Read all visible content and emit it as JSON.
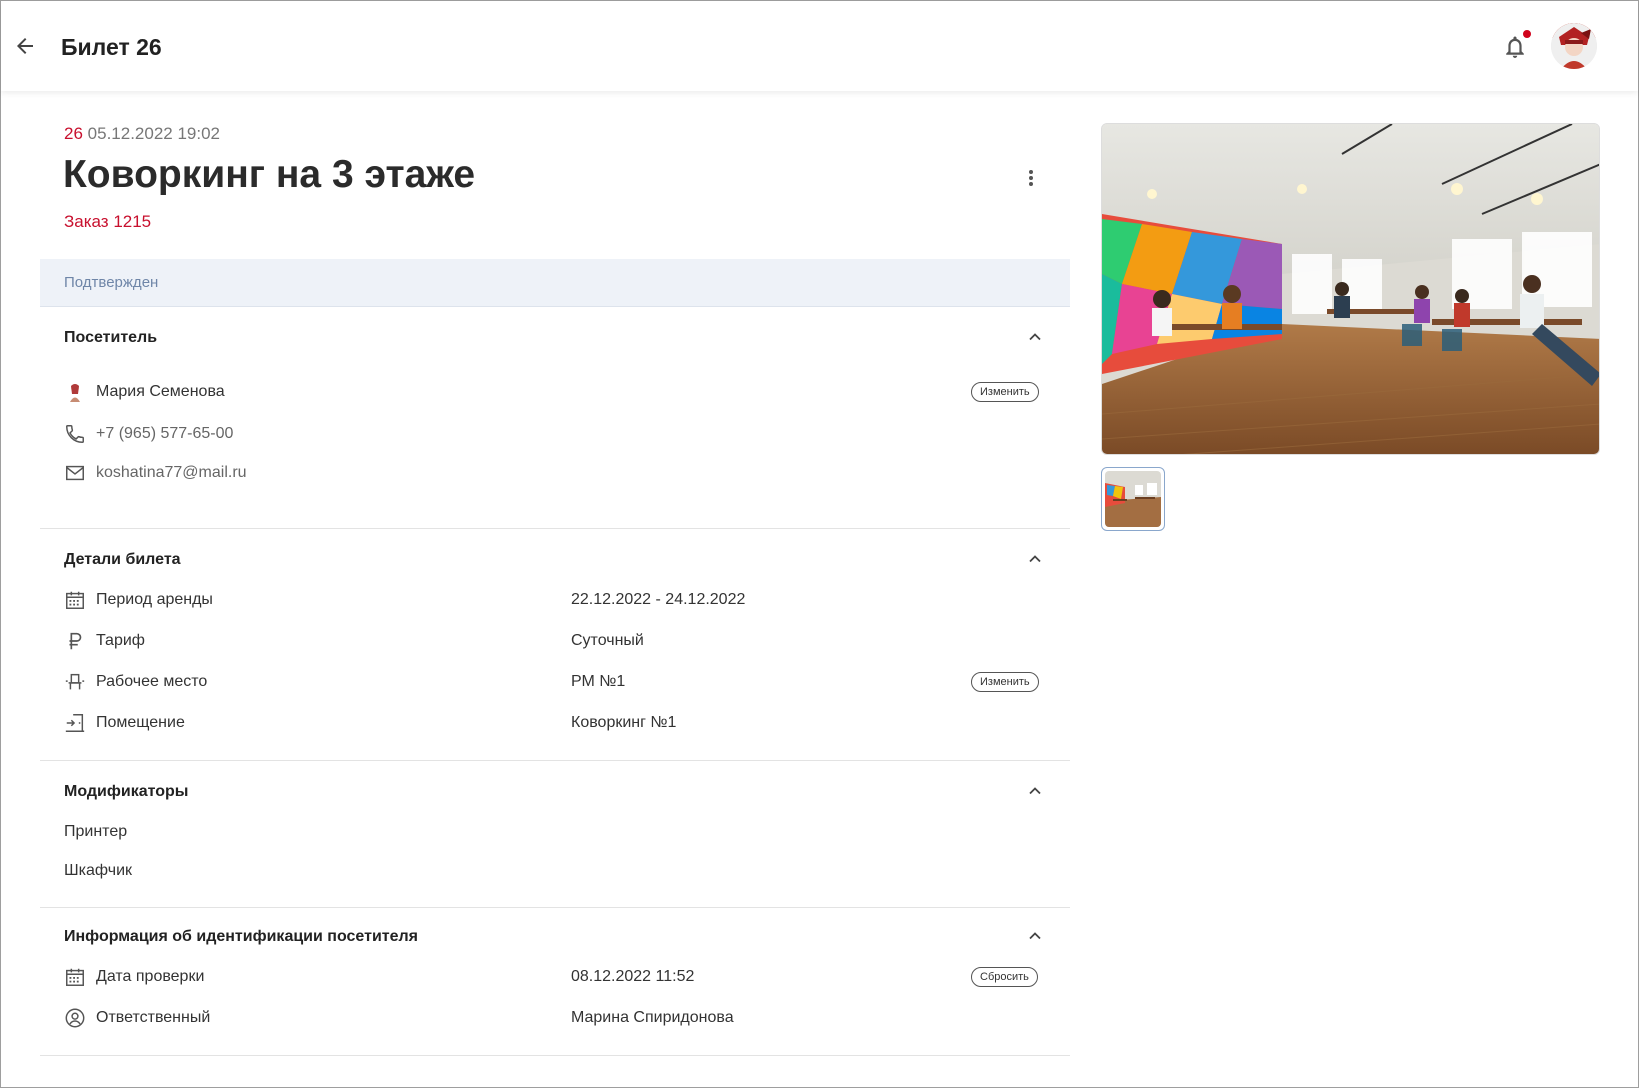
{
  "header": {
    "title": "Билет 26",
    "icons": {
      "back": "arrow-left-icon",
      "notifications": "bell-icon",
      "avatar": "user-avatar"
    },
    "has_unread": true
  },
  "ticket": {
    "number": "26",
    "datetime": "05.12.2022 19:02",
    "title": "Коворкинг на 3 этаже",
    "order_link": "Заказ 1215",
    "status": "Подтвержден"
  },
  "visitor": {
    "title": "Посетитель",
    "name": "Мария Семенова",
    "phone": "+7 (965) 577-65-00",
    "email": "koshatina77@mail.ru",
    "change_label": "Изменить"
  },
  "details": {
    "title": "Детали билета",
    "rows": [
      {
        "label": "Период аренды",
        "value": "22.12.2022 - 24.12.2022",
        "icon": "calendar-icon"
      },
      {
        "label": "Тариф",
        "value": "Суточный",
        "icon": "ruble-icon"
      },
      {
        "label": "Рабочее место",
        "value": "РМ №1",
        "icon": "workplace-icon"
      },
      {
        "label": "Помещение",
        "value": "Коворкинг №1",
        "icon": "door-enter-icon"
      }
    ],
    "change_label": "Изменить"
  },
  "modifiers": {
    "title": "Модификаторы",
    "items": [
      "Принтер",
      "Шкафчик"
    ]
  },
  "identification": {
    "title": "Информация об идентификации посетителя",
    "rows": [
      {
        "label": "Дата проверки",
        "value": "08.12.2022 11:52",
        "icon": "calendar-icon"
      },
      {
        "label": "Ответственный",
        "value": "Марина Спиридонова",
        "icon": "account-circle-icon"
      }
    ],
    "reset_label": "Сбросить"
  },
  "colors": {
    "accent": "#c8102e",
    "status_bg": "#eef2f8",
    "status_text": "#6f86a8"
  }
}
